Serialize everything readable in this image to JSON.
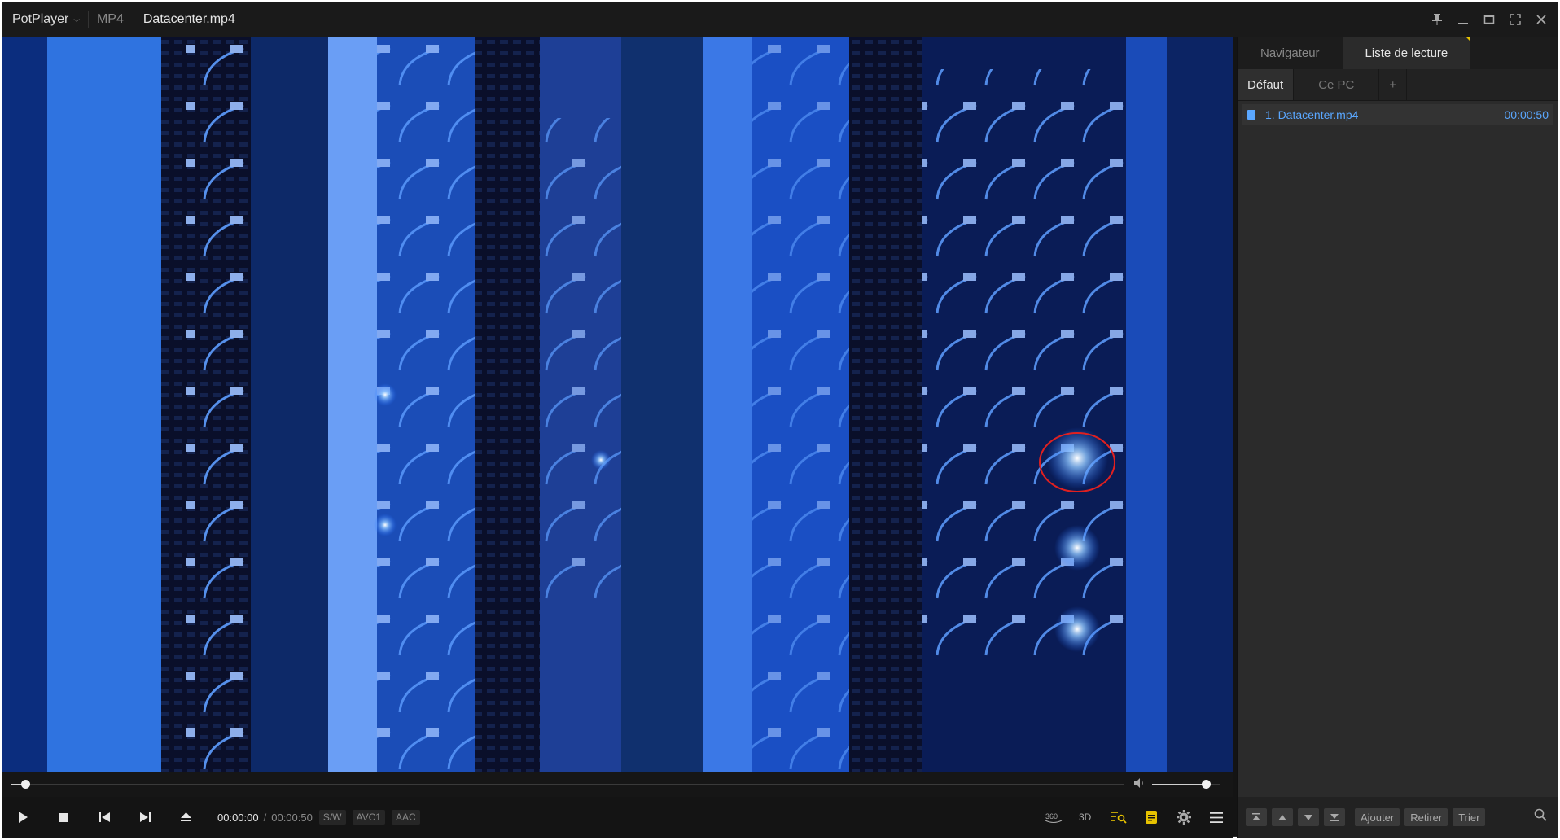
{
  "title_bar": {
    "app_name": "PotPlayer",
    "format": "MP4",
    "file_title": "Datacenter.mp4"
  },
  "player": {
    "current_time": "00:00:00",
    "separator": "/",
    "duration": "00:00:50",
    "decoder_tag": "S/W",
    "video_codec": "AVC1",
    "audio_codec": "AAC",
    "seek_progress": 0.013,
    "volume_level": 0.78
  },
  "panel": {
    "tabs": [
      "Navigateur",
      "Liste de lecture"
    ],
    "subtabs": [
      "Défaut",
      "Ce PC",
      "+"
    ],
    "playlist": [
      {
        "label": "1. Datacenter.mp4",
        "duration": "00:00:50"
      }
    ],
    "buttons": [
      "Ajouter",
      "Retirer",
      "Trier"
    ]
  },
  "icons": {
    "right_controls": [
      "360-icon",
      "3d-icon",
      "playlist-search-icon",
      "subtitle-icon",
      "settings-gear-icon",
      "menu-icon"
    ],
    "accent_color": "#e7c200",
    "link_color": "#5aa7ff"
  }
}
